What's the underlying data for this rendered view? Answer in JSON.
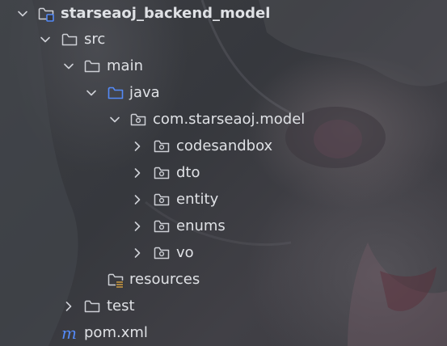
{
  "tree": {
    "root": {
      "label": "starseaoj_backend_model",
      "icon": "module-folder-icon",
      "expanded": true
    },
    "src": {
      "label": "src",
      "icon": "folder-icon",
      "expanded": true
    },
    "main": {
      "label": "main",
      "icon": "folder-icon",
      "expanded": true
    },
    "java": {
      "label": "java",
      "icon": "source-root-folder-icon",
      "expanded": true
    },
    "package": {
      "label": "com.starseaoj.model",
      "icon": "package-icon",
      "expanded": true
    },
    "codesandbox": {
      "label": "codesandbox",
      "icon": "package-icon",
      "expanded": false
    },
    "dto": {
      "label": "dto",
      "icon": "package-icon",
      "expanded": false
    },
    "entity": {
      "label": "entity",
      "icon": "package-icon",
      "expanded": false
    },
    "enums": {
      "label": "enums",
      "icon": "package-icon",
      "expanded": false
    },
    "vo": {
      "label": "vo",
      "icon": "package-icon",
      "expanded": false
    },
    "resources": {
      "label": "resources",
      "icon": "resources-folder-icon"
    },
    "test": {
      "label": "test",
      "icon": "folder-icon",
      "expanded": false
    },
    "pom": {
      "label": "pom.xml",
      "icon": "maven-icon"
    }
  },
  "colors": {
    "text": "#dfe1e5",
    "icon": "#ced0d6",
    "source_root": "#548af7",
    "maven": "#548af7",
    "resources_accent": "#d9a343"
  }
}
